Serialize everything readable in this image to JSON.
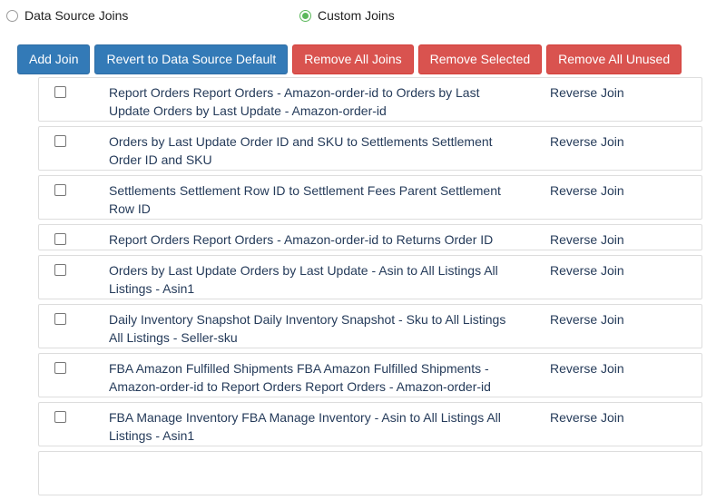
{
  "radio": {
    "data_source_label": "Data Source Joins",
    "custom_label": "Custom Joins",
    "selected": "custom"
  },
  "toolbar": {
    "add_join": "Add Join",
    "revert": "Revert to Data Source Default",
    "remove_all": "Remove All Joins",
    "remove_selected": "Remove Selected",
    "remove_unused": "Remove All Unused"
  },
  "colors": {
    "primary": "#337ab7",
    "danger": "#d9534f",
    "radio_checked": "#5cb85c"
  },
  "joins": [
    {
      "line1": "Report Orders Report Orders - Amazon-order-id to Orders by Last",
      "line2": "Update Orders by Last Update - Amazon-order-id",
      "reverse": "Reverse Join"
    },
    {
      "line1": "Orders by Last Update Order ID and SKU to Settlements Settlement",
      "line2": "Order ID and SKU",
      "reverse": "Reverse Join"
    },
    {
      "line1": "Settlements Settlement Row ID to Settlement Fees Parent Settlement",
      "line2": "Row ID",
      "reverse": "Reverse Join"
    },
    {
      "line1": "Report Orders Report Orders - Amazon-order-id to Returns Order ID",
      "line2": "",
      "reverse": "Reverse Join"
    },
    {
      "line1": "Orders by Last Update Orders by Last Update - Asin to All Listings All",
      "line2": "Listings - Asin1",
      "reverse": "Reverse Join"
    },
    {
      "line1": "Daily Inventory Snapshot Daily Inventory Snapshot - Sku to All Listings",
      "line2": "All Listings - Seller-sku",
      "reverse": "Reverse Join"
    },
    {
      "line1": "FBA Amazon Fulfilled Shipments FBA Amazon Fulfilled Shipments -",
      "line2": "Amazon-order-id to Report Orders Report Orders - Amazon-order-id",
      "reverse": "Reverse Join"
    },
    {
      "line1": "FBA Manage Inventory FBA Manage Inventory - Asin to All Listings All",
      "line2": "Listings - Asin1",
      "reverse": "Reverse Join"
    }
  ]
}
